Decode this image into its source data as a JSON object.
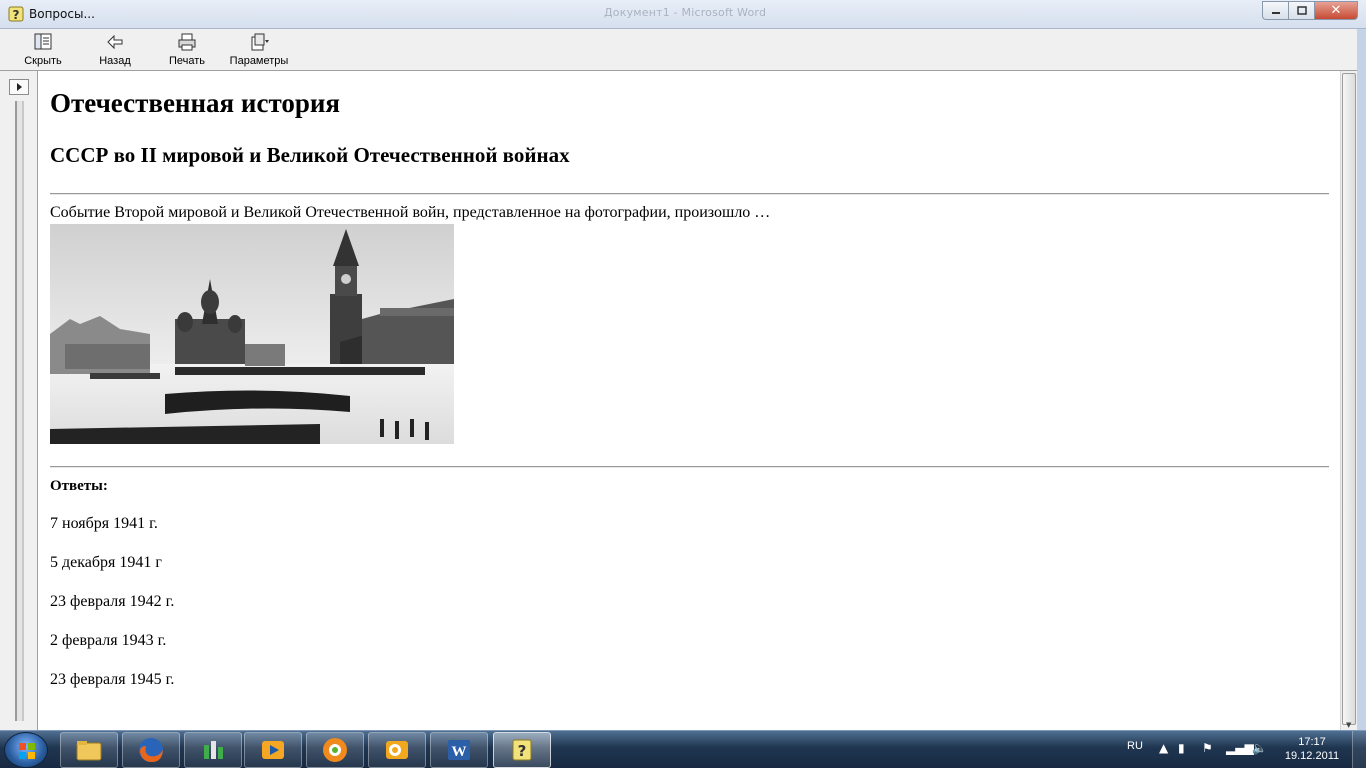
{
  "window": {
    "title": "Вопросы...",
    "background_title": "Документ1 - Microsoft Word",
    "buttons": {
      "minimize": "minimize-icon",
      "maximize": "maximize-icon",
      "close": "✕"
    }
  },
  "toolbar": {
    "items": [
      {
        "label": "Скрыть",
        "icon": "hide-pane-icon"
      },
      {
        "label": "Назад",
        "icon": "back-arrow-icon"
      },
      {
        "label": "Печать",
        "icon": "printer-icon"
      },
      {
        "label": "Параметры",
        "icon": "options-icon"
      }
    ]
  },
  "content": {
    "heading": "Отечественная история",
    "subheading": "СССР во II мировой и Великой Отечественной войнах",
    "question": "Событие Второй мировой и Великой Отечественной войн, представленное на фотографии, произошло …",
    "photo": "Parade on Red Square (black-and-white photograph)",
    "answers_label": "Ответы:",
    "answers": [
      "7 ноября 1941 г.",
      "5 декабря 1941 г",
      "23 февраля 1942 г.",
      "2 февраля 1943 г.",
      "23 февраля 1945 г."
    ]
  },
  "taskbar": {
    "apps": [
      "explorer-icon",
      "firefox-icon",
      "app-icon",
      "media-player-icon",
      "icq-icon",
      "outlook-icon",
      "word-icon",
      "help-icon"
    ],
    "tray": {
      "language": "RU"
    },
    "clock": {
      "time": "17:17",
      "date": "19.12.2011"
    }
  },
  "colors": {
    "titlebar": "#d5dfee",
    "toolbar": "#f0f0f0",
    "taskbar": "#1f3550",
    "close": "#c64a34"
  }
}
